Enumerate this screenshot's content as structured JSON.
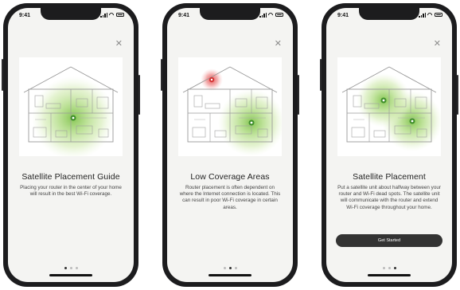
{
  "status_bar": {
    "time": "9:41"
  },
  "icons": {
    "close": "close-icon",
    "signal": "signal-icon",
    "wifi": "wifi-icon",
    "battery": "battery-icon"
  },
  "colors": {
    "coverage_green": "#9fd36a",
    "weak_red": "#e65a5a",
    "button_bg": "#333333",
    "screen_bg": "#f4f4f2"
  },
  "screens": [
    {
      "title": "Satellite Placement Guide",
      "description": "Placing your router in the center of your home will result in the best Wi-Fi coverage.",
      "active_page": 1
    },
    {
      "title": "Low Coverage Areas",
      "description": "Router placement is often dependent on where the Internet connection is located. This can result in poor Wi-Fi coverage in certain areas.",
      "active_page": 2
    },
    {
      "title": "Satellite Placement",
      "description": "Put a satellite unit about halfway between your router and Wi-Fi dead spots. The satellite unit will communicate with the router and extend Wi-Fi coverage throughout your home.",
      "button_label": "Get Started",
      "active_page": 3
    }
  ],
  "pagination": {
    "total_pages": 3
  }
}
